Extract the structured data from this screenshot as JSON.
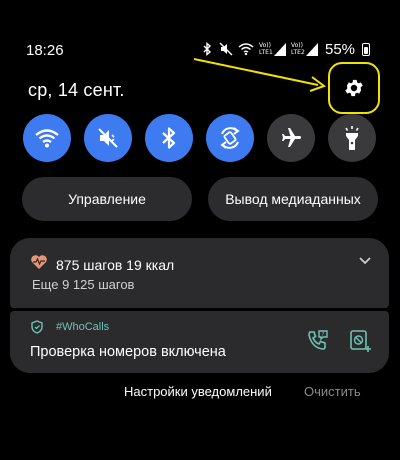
{
  "status_bar": {
    "time": "18:26",
    "sim1_label": "Vo)) LTE1",
    "sim2_label": "Vo)) LTE2",
    "battery_percent": "55%",
    "battery_level": 0.55,
    "icons": [
      "bluetooth-icon",
      "mute-icon",
      "wifi-icon",
      "signal-sim1-icon",
      "signal-sim2-icon",
      "battery-icon"
    ]
  },
  "header": {
    "date": "ср, 14 сент.",
    "settings_icon": "gear-icon",
    "highlight_color": "#f2e200"
  },
  "quick_tiles": [
    {
      "name": "wifi",
      "icon": "wifi-icon",
      "active": true
    },
    {
      "name": "sound-mute",
      "icon": "mute-icon",
      "active": true
    },
    {
      "name": "bluetooth",
      "icon": "bluetooth-icon",
      "active": true
    },
    {
      "name": "auto-rotate",
      "icon": "rotate-icon",
      "active": true
    },
    {
      "name": "airplane",
      "icon": "airplane-icon",
      "active": false
    },
    {
      "name": "flashlight",
      "icon": "flashlight-icon",
      "active": false
    }
  ],
  "pills": {
    "control": "Управление",
    "media_output": "Вывод медиаданных"
  },
  "notifications": {
    "steps": {
      "title": "875 шагов 19 ккал",
      "subtitle": "Еще 9 125 шагов"
    },
    "whocalls": {
      "app": "#WhoCalls",
      "text": "Проверка номеров включена"
    }
  },
  "footer": {
    "settings": "Настройки уведомлений",
    "clear": "Очистить"
  },
  "colors": {
    "accent": "#3e7bf0",
    "tile_off": "#3a3a3c",
    "card": "#2b2b2d",
    "whocalls_accent": "#6fc3b3"
  }
}
